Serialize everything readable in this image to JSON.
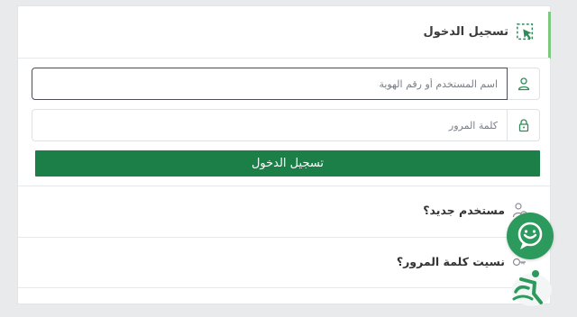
{
  "header": {
    "title": "تسجيل الدخول",
    "icon": "cursor-select-icon"
  },
  "form": {
    "username": {
      "value": "",
      "placeholder": "اسم المستخدم أو رقم الهوية",
      "icon": "user-icon"
    },
    "password": {
      "value": "",
      "placeholder": "كلمة المرور",
      "icon": "lock-icon"
    },
    "submit_label": "تسجيل الدخول"
  },
  "links": {
    "new_user": {
      "label": "مستخدم جديد؟",
      "icon": "user-add-icon"
    },
    "forgot_password": {
      "label": "نسيت كلمة المرور؟",
      "icon": "key-icon"
    }
  },
  "widgets": {
    "chat": "chat-assistant-icon",
    "accessibility": "accessibility-icon"
  },
  "colors": {
    "primary": "#1b7f47",
    "accent": "#7dc97f",
    "icon_green": "#2e8b57",
    "widget_green": "#2c9a5c"
  }
}
